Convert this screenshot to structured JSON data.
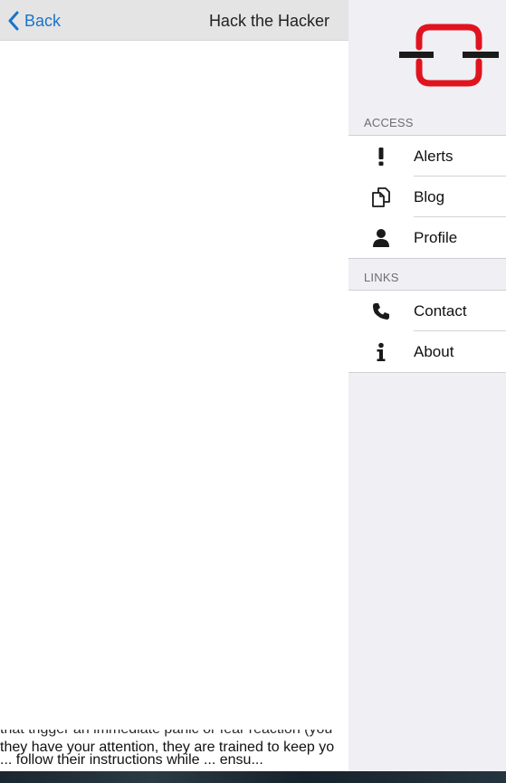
{
  "navbar": {
    "back_label": "Back",
    "title": "Hack the Hacker"
  },
  "article": {
    "lines": [
      "that trigger an immediate panic or fear reaction (you",
      "they have your attention, they are trained to keep yo",
      "... follow their instructions while ... ensu..."
    ]
  },
  "sidemenu": {
    "logo": "hack-the-hacker-logo",
    "sections": [
      {
        "header": "ACCESS",
        "items": [
          {
            "label": "Alerts",
            "icon": "exclamation-icon"
          },
          {
            "label": "Blog",
            "icon": "documents-icon"
          },
          {
            "label": "Profile",
            "icon": "user-icon"
          }
        ]
      },
      {
        "header": "LINKS",
        "items": [
          {
            "label": "Contact",
            "icon": "phone-icon"
          },
          {
            "label": "About",
            "icon": "info-icon"
          }
        ]
      }
    ]
  },
  "colors": {
    "accent": "#1a73c9",
    "logo_red": "#e0141e",
    "navbar_bg": "#e4e4e4",
    "menu_bg": "#efeff4"
  }
}
